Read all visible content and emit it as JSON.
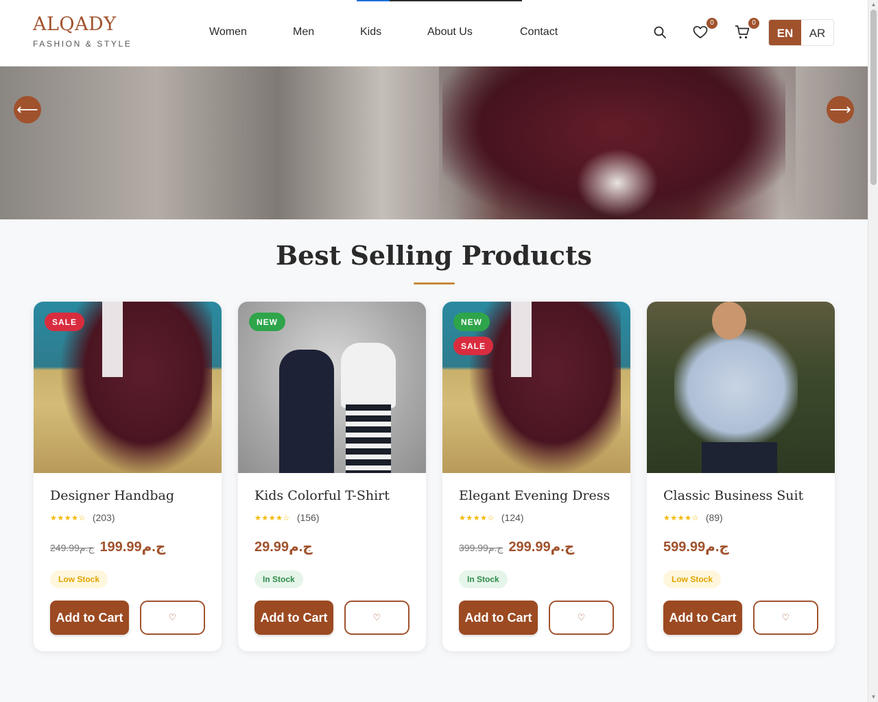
{
  "brand": {
    "name": "ALQADY",
    "tagline": "FASHION & STYLE"
  },
  "nav": {
    "items": [
      "Women",
      "Men",
      "Kids",
      "About Us",
      "Contact"
    ]
  },
  "header_icons": {
    "search": "search-icon",
    "wishlist_count": "0",
    "cart_count": "0"
  },
  "language": {
    "active": "EN",
    "alternate": "AR"
  },
  "hero": {
    "prev": "⟵",
    "next": "⟶"
  },
  "section": {
    "title": "Best Selling Products"
  },
  "products": [
    {
      "name": "Designer Handbag",
      "stars": "★★★★☆",
      "reviews": "(203)",
      "old_price": "249.99ج.م",
      "price": "199.99ج.م",
      "stock": "Low Stock",
      "tags": [
        "SALE"
      ],
      "cart": "Add to Cart",
      "wish": "♡"
    },
    {
      "name": "Kids Colorful T-Shirt",
      "stars": "★★★★☆",
      "reviews": "(156)",
      "old_price": "",
      "price": "29.99ج.م",
      "stock": "In Stock",
      "tags": [
        "NEW"
      ],
      "cart": "Add to Cart",
      "wish": "♡"
    },
    {
      "name": "Elegant Evening Dress",
      "stars": "★★★★☆",
      "reviews": "(124)",
      "old_price": "399.99ج.م",
      "price": "299.99ج.م",
      "stock": "In Stock",
      "tags": [
        "NEW",
        "SALE"
      ],
      "cart": "Add to Cart",
      "wish": "♡"
    },
    {
      "name": "Classic Business Suit",
      "stars": "★★★★☆",
      "reviews": "(89)",
      "old_price": "",
      "price": "599.99ج.م",
      "stock": "Low Stock",
      "tags": [],
      "cart": "Add to Cart",
      "wish": "♡"
    }
  ],
  "colors": {
    "accent": "#a0522d",
    "sale": "#d92d3f",
    "new": "#2ea54a",
    "gold": "#c6893b"
  }
}
